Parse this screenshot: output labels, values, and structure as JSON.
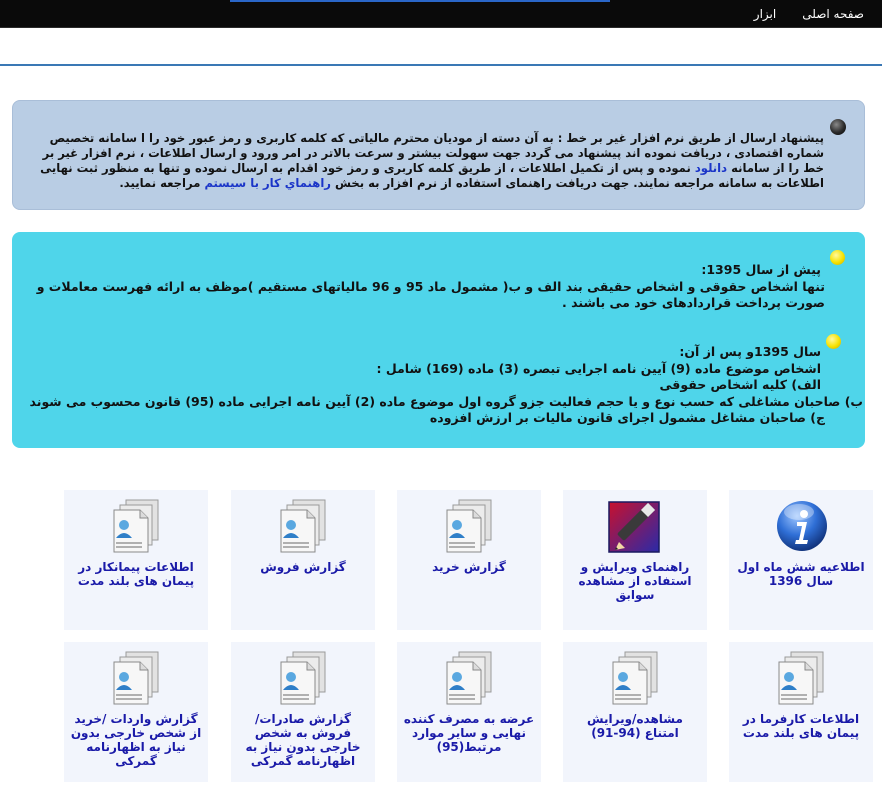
{
  "nav": {
    "home": "صفحه اصلی",
    "tools": "ابزار"
  },
  "notice": {
    "text_a": "پیشنهاد ارسال از طریق نرم افزار غیر بر خط : به آن دسته از مودیان محترم مالیاتی که کلمه کاربری و رمز عبور خود را ا سامانه تخصیص شماره اقتصادی ، دریافت نموده اند پیشنهاد می گردد جهت سهولت بیشتر و سرعت بالاتر در امر ورود و ارسال اطلاعات ، نرم افزار غیر بر خط را از سامانه",
    "download_link": "دانلود",
    "text_b": "نموده و پس از تکمیل اطلاعات ، از طریق کلمه کاربری و رمز خود اقدام به ارسال نموده و تنها به منظور ثبت نهایی اطلاعات به سامانه مراجعه نمایند. جهت دریافت راهنمای استفاده از نرم افزار به بخش",
    "guide_link": "راهنماي کار با سيستم",
    "text_c": "مراجعه نمایید."
  },
  "rules": {
    "before_title": "پیش از سال 1395:",
    "before_body": "تنها اشخاص حقوقی و اشخاص حقیقی بند الف و ب( مشمول ماد 95 و 96 مالیاتهای مستقیم )موظف به ارائه فهرست معاملات و صورت پرداخت قراردادهای خود می باشند .",
    "after_title": "سال  1395و پس از آن:",
    "after_intro": "اشخاص موضوع ماده (9) آیین نامه اجرایی تبصره (3) ماده (169) شامل :",
    "item_a": "الف) کلیه اشخاص حقوقی",
    "item_b": "ب) صاحبان مشاغلی که حسب نوع و یا حجم فعالیت جزو گروه اول موضوع ماده (2) آیین نامه اجرایی ماده (95) قانون محسوب می شوند",
    "item_c": "ج) صاحبان مشاغل مشمول اجرای قانون مالیات بر ارزش افزوده"
  },
  "tiles": [
    {
      "label": "اطلاعیه شش ماه اول سال 1396",
      "icon": "info-icon"
    },
    {
      "label": "راهنمای ویرایش و استفاده از مشاهده سوابق",
      "icon": "pencil-icon"
    },
    {
      "label": "گزارش خرید",
      "icon": "document-user-icon"
    },
    {
      "label": "گزارش فروش",
      "icon": "document-user-icon"
    },
    {
      "label": "اطلاعات پیمانکار در پیمان های بلند مدت",
      "icon": "document-user-icon"
    },
    {
      "label": "اطلاعات کارفرما در پیمان های بلند مدت",
      "icon": "document-user-icon"
    },
    {
      "label": "مشاهده/ویرایش امتناع (94-91)",
      "icon": "document-user-icon"
    },
    {
      "label": "عرضه به مصرف کننده نهایی و سایر موارد مرتبط(95)",
      "icon": "document-user-icon"
    },
    {
      "label": "گزارش صادرات/فروش به شخص خارجی بدون نیاز به اظهارنامه گمرکی",
      "icon": "document-user-icon"
    },
    {
      "label": "گزارش واردات /خرید از شخص خارجی بدون نیاز به اظهارنامه گمرکی",
      "icon": "document-user-icon"
    }
  ],
  "colors": {
    "topbar": "#0a0a0a",
    "notice_bg": "#b9cde4",
    "rules_bg": "#4fd5ea",
    "tile_bg": "#f2f5fc",
    "tile_text": "#1a1aa8",
    "link": "#1b35c8"
  }
}
